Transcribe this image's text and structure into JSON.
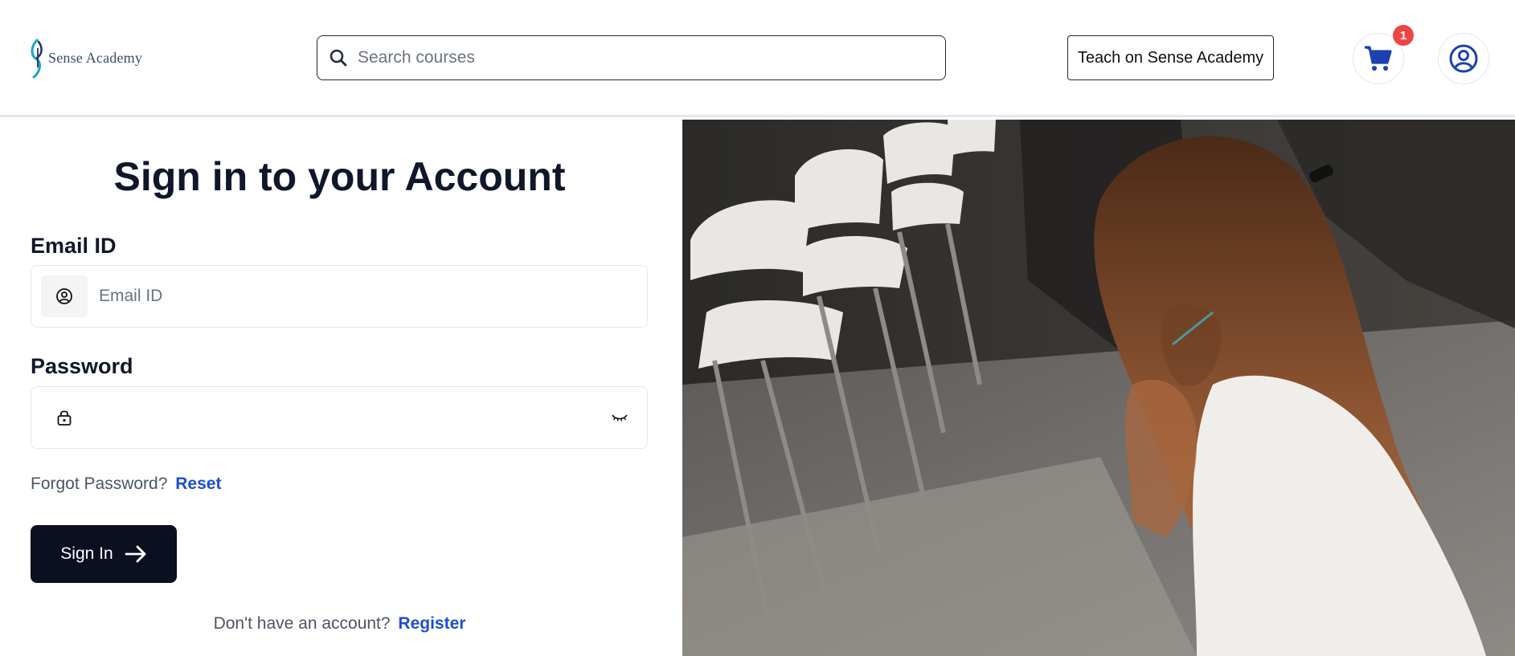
{
  "header": {
    "logo_text": "Sense Academy",
    "search_placeholder": "Search courses",
    "search_value": "",
    "teach_label": "Teach on Sense Academy",
    "cart_count": "1",
    "icons": {
      "search": "search-icon",
      "cart": "cart-icon",
      "profile": "user-circle-icon"
    }
  },
  "form": {
    "title": "Sign in to your Account",
    "email_label": "Email ID",
    "email_placeholder": "Email ID",
    "email_value": "",
    "password_label": "Password",
    "password_value": "",
    "forgot_text": "Forgot Password?",
    "reset_link": "Reset",
    "signin_label": "Sign In",
    "register_text": "Don't have an account?",
    "register_link": "Register",
    "icons": {
      "email": "user-circle-icon",
      "password": "lock-icon",
      "toggle": "eye-closed-icon",
      "signin": "arrow-right-icon"
    }
  },
  "colors": {
    "primary_button": "#0b0f1f",
    "link": "#1d4ed8",
    "cart_icon": "#1e40af",
    "badge": "#ef4444"
  },
  "hero_image": {
    "icon": "photo-student-in-classroom"
  }
}
